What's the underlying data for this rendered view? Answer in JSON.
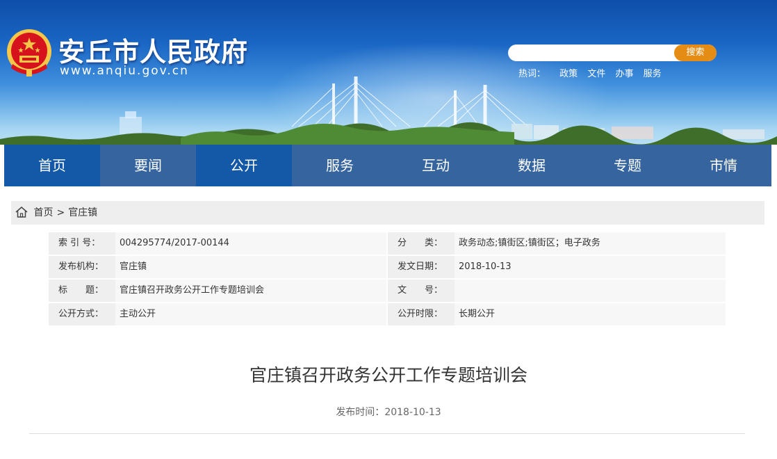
{
  "header": {
    "site_title": "安丘市人民政府",
    "site_url": "www.anqiu.gov.cn",
    "search": {
      "placeholder": "",
      "button_label": "搜索"
    },
    "hotwords": {
      "label": "热词：",
      "items": [
        "政策",
        "文件",
        "办事",
        "服务"
      ]
    }
  },
  "nav": {
    "items": [
      "首页",
      "要闻",
      "公开",
      "服务",
      "互动",
      "数据",
      "专题",
      "市情"
    ]
  },
  "breadcrumb": {
    "home": "首页",
    "separator": ">",
    "current": "官庄镇"
  },
  "meta": {
    "rows": [
      {
        "label1": "索 引 号：",
        "value1": "004295774/2017-00144",
        "label2": "分　　类：",
        "value2": "政务动态;镇街区;镇街区；电子政务"
      },
      {
        "label1": "发布机构：",
        "value1": "官庄镇",
        "label2": "发文日期：",
        "value2": "2018-10-13"
      },
      {
        "label1": "标　　题：",
        "value1": "官庄镇召开政务公开工作专题培训会",
        "label2": "文　　号：",
        "value2": ""
      },
      {
        "label1": "公开方式：",
        "value1": "主动公开",
        "label2": "公开时限：",
        "value2": "长期公开"
      }
    ]
  },
  "article": {
    "title": "官庄镇召开政务公开工作专题培训会",
    "publish_label": "发布时间：",
    "publish_date": "2018-10-13"
  },
  "colors": {
    "nav_dark": "#1459a7",
    "nav_light": "#36649e",
    "search_button": "#e48c14",
    "emblem_red": "#d6131c",
    "emblem_gold": "#f6c648"
  },
  "icons": [
    "national-emblem-icon",
    "home-icon"
  ]
}
